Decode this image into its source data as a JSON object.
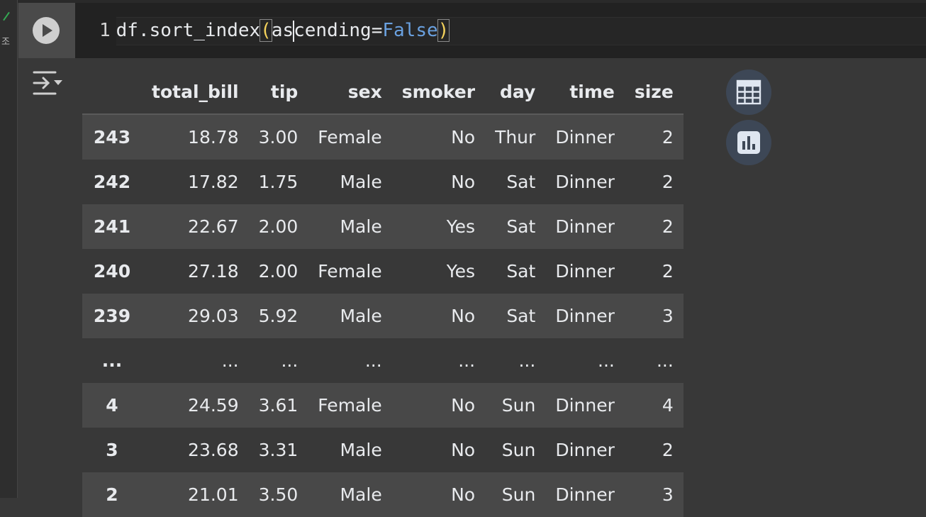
{
  "gutter": {
    "status_char": "조"
  },
  "code": {
    "line_number": "1",
    "prefix": "df.sort_index",
    "open_paren": "(",
    "arg_before_cursor": "as",
    "arg_after_cursor": "cending=",
    "keyword": "False",
    "close_paren": ")"
  },
  "table": {
    "columns": [
      "",
      "total_bill",
      "tip",
      "sex",
      "smoker",
      "day",
      "time",
      "size"
    ],
    "rows": [
      [
        "243",
        "18.78",
        "3.00",
        "Female",
        "No",
        "Thur",
        "Dinner",
        "2"
      ],
      [
        "242",
        "17.82",
        "1.75",
        "Male",
        "No",
        "Sat",
        "Dinner",
        "2"
      ],
      [
        "241",
        "22.67",
        "2.00",
        "Male",
        "Yes",
        "Sat",
        "Dinner",
        "2"
      ],
      [
        "240",
        "27.18",
        "2.00",
        "Female",
        "Yes",
        "Sat",
        "Dinner",
        "2"
      ],
      [
        "239",
        "29.03",
        "5.92",
        "Male",
        "No",
        "Sat",
        "Dinner",
        "3"
      ],
      [
        "...",
        "...",
        "...",
        "...",
        "...",
        "...",
        "...",
        "..."
      ],
      [
        "4",
        "24.59",
        "3.61",
        "Female",
        "No",
        "Sun",
        "Dinner",
        "4"
      ],
      [
        "3",
        "23.68",
        "3.31",
        "Male",
        "No",
        "Sun",
        "Dinner",
        "2"
      ],
      [
        "2",
        "21.01",
        "3.50",
        "Male",
        "No",
        "Sun",
        "Dinner",
        "3"
      ]
    ]
  },
  "colors": {
    "cell_background": "#383838",
    "editor_background": "#222222",
    "keyword_blue": "#6aa1e0",
    "bracket_yellow": "#f5d35c",
    "side_button_bg": "#3d4756"
  },
  "icons": {
    "run": "play-icon",
    "output_toggle": "output-collapse-icon",
    "table_view": "table-icon",
    "chart_view": "bar-chart-icon"
  }
}
